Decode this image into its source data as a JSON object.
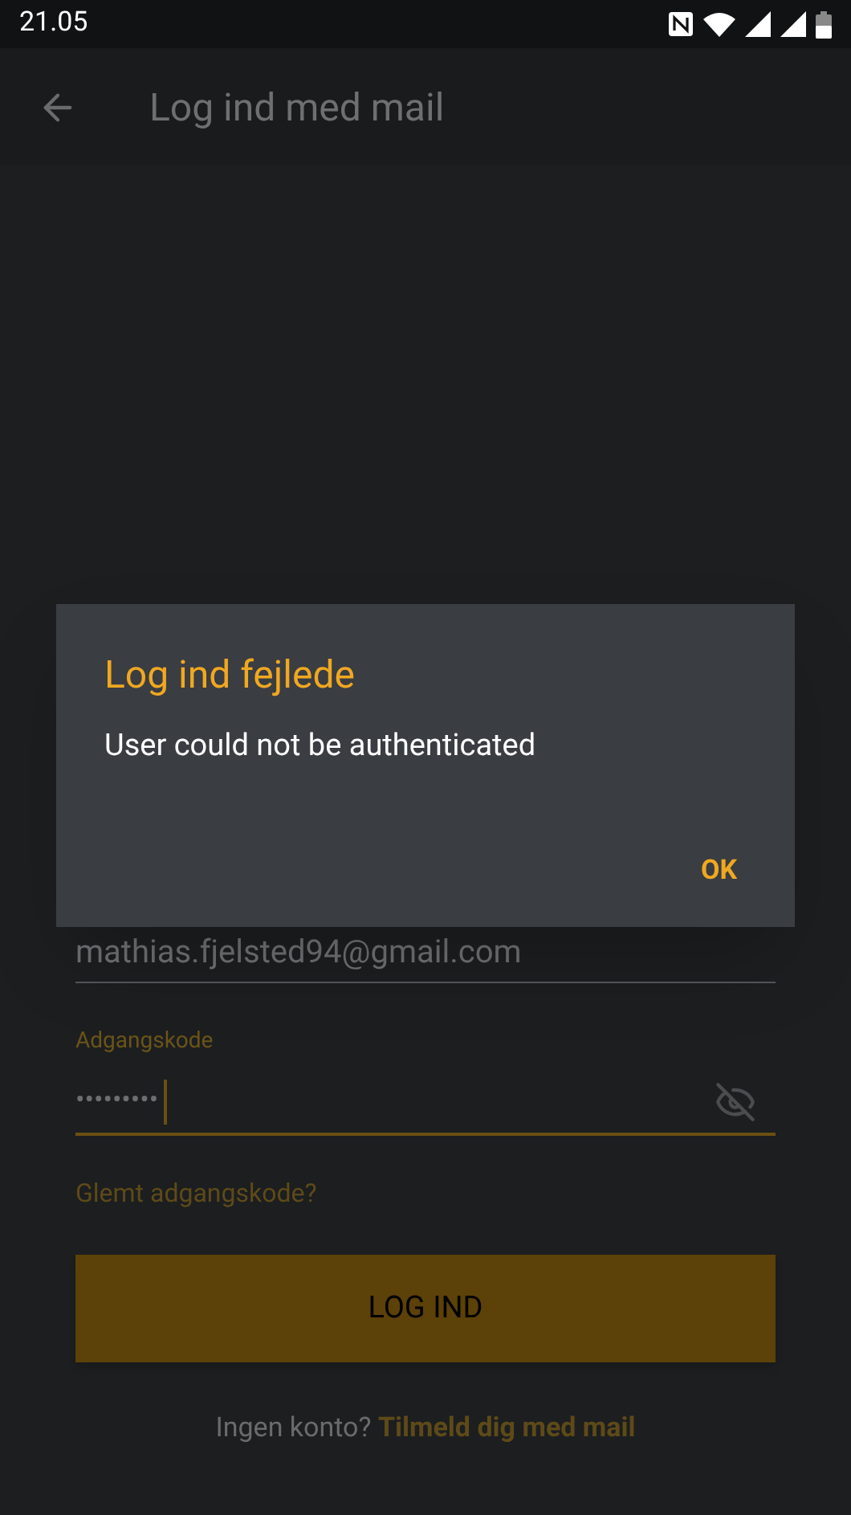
{
  "status_bar": {
    "time": "21.05"
  },
  "app_bar": {
    "title": "Log ind med mail"
  },
  "email_field": {
    "value": "mathias.fjelsted94@gmail.com"
  },
  "password_field": {
    "label": "Adgangskode",
    "value": "•••••••••",
    "focused": true
  },
  "forgot_link": "Glemt adgangskode?",
  "login_button": "LOG IND",
  "signup": {
    "prompt": "Ingen konto?",
    "link": "Tilmeld dig med mail"
  },
  "dialog": {
    "title": "Log ind fejlede",
    "message": "User could not be authenticated",
    "buttons": [
      "OK"
    ]
  }
}
